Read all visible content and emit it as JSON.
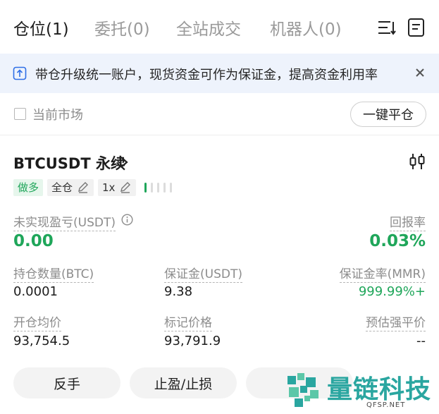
{
  "tabs": [
    {
      "label": "仓位(1)",
      "active": true
    },
    {
      "label": "委托(0)"
    },
    {
      "label": "全站成交"
    },
    {
      "label": "机器人(0)"
    }
  ],
  "header_icons": {
    "sort": "sort-lines-icon",
    "document": "document-icon"
  },
  "banner": {
    "text": "带仓升级统一账户，现货资金可作为保证金，提高资金利用率",
    "icon": "upgrade-icon",
    "close_icon": "close-icon"
  },
  "filter": {
    "current_market_label": "当前市场",
    "close_all_label": "一键平仓"
  },
  "position": {
    "symbol": "BTCUSDT 永续",
    "side_tag": "做多",
    "margin_mode_tag": "全仓",
    "leverage_tag": "1x",
    "risk_level_bars_filled": 1,
    "risk_level_bars_total": 5,
    "unrealized_pnl_label": "未实现盈亏(USDT)",
    "unrealized_pnl_value": "0.00",
    "roe_label": "回报率",
    "roe_value": "0.03%",
    "size_label": "持仓数量(BTC)",
    "size_value": "0.0001",
    "margin_label": "保证金(USDT)",
    "margin_value": "9.38",
    "mmr_label": "保证金率(MMR)",
    "mmr_value": "999.99%+",
    "entry_label": "开仓均价",
    "entry_value": "93,754.5",
    "mark_label": "标记价格",
    "mark_value": "93,791.9",
    "liq_label": "预估强平价",
    "liq_value": "--"
  },
  "actions": {
    "reverse": "反手",
    "tpsl": "止盈/止损"
  },
  "watermark": {
    "name": "量链科技",
    "domain": "QFSP.NET"
  },
  "colors": {
    "green": "#1fa65a",
    "banner_bg": "#eef3fc",
    "watermark": "#2aa6a0"
  }
}
